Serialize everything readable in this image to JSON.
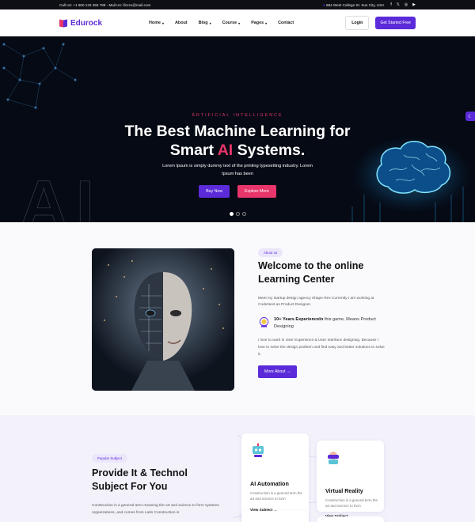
{
  "topbar": {
    "contact": "Call Us: +1 800 123 456 789 - Mail Us: ificrzu@mail.com",
    "address": "684 West College St. Sun City, USA",
    "social": [
      "f",
      "𝕏",
      "◎",
      "▶"
    ]
  },
  "nav": {
    "logo": "Edurock",
    "menu": [
      {
        "label": "Home",
        "dropdown": true
      },
      {
        "label": "About",
        "dropdown": false
      },
      {
        "label": "Blog",
        "dropdown": true
      },
      {
        "label": "Course",
        "dropdown": true
      },
      {
        "label": "Pages",
        "dropdown": true
      },
      {
        "label": "Contact",
        "dropdown": false
      }
    ],
    "login": "Login",
    "cta": "Get Started Free"
  },
  "hero": {
    "eyebrow": "ARTIFICIAL INTELLIGENCE",
    "title_line1": "The Best Machine Learning for",
    "title_pre": "Smart ",
    "title_highlight": "AI",
    "title_post": " Systems.",
    "text": "Lorem Ipsum is simply dummy text of the printing typesetting industry. Lorem Ipsum has been",
    "btn_primary": "Buy Now",
    "btn_secondary": "Explore More",
    "bg_text": "AI",
    "slides": 3,
    "active_slide": 1
  },
  "about": {
    "pill": "About us",
    "title": "Welcome to the online Learning Center",
    "text1": "Meet my startup design agency Shape Rex Currently I am working at CodeNext as Product Designer.",
    "badge_bold": "10+ Years ExperienceIn",
    "badge_rest": " this game, Means Product Designing",
    "text2": "I love to work in User Experience & User Interface designing. Because I love to solve the design problem and find easy and better solutions to solve it.",
    "button": "More About →"
  },
  "subjects": {
    "pill": "Popular Subject",
    "title": "Provide It & Technol Subject For You",
    "text": "Construction is a general term meaning the art and science to form systems organizations, and comes from Latin Construction is",
    "cards": [
      {
        "title": "AI Automation",
        "desc": "Construction is a general term the art and science to form",
        "link": "View Subject →"
      },
      {
        "title": "Virtual Reality",
        "desc": "Construction is a general term the art and science to form",
        "link": "View Subject →"
      }
    ]
  },
  "colors": {
    "primary": "#5b2bd9",
    "accent": "#e8356b",
    "dark": "#050a14"
  }
}
